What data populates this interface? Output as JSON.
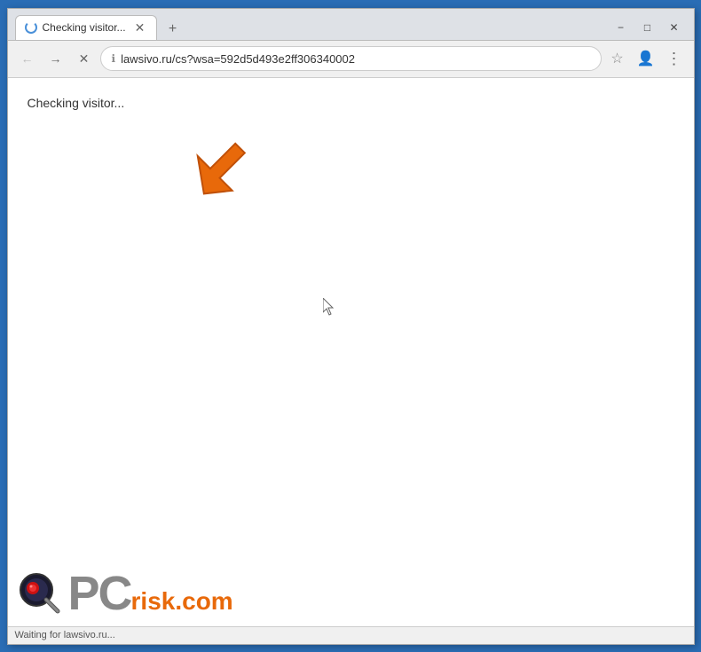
{
  "window": {
    "title": "Checking visitor...",
    "tab_title": "Checking visitor...",
    "new_tab_label": "+",
    "close_label": "✕",
    "minimize_label": "−",
    "maximize_label": "□",
    "close_win_label": "✕"
  },
  "toolbar": {
    "back_label": "←",
    "forward_label": "→",
    "reload_label": "✕",
    "address": "lawsivo.ru/cs?wsa=592d5d493e2ff306340002",
    "star_label": "☆",
    "menu_label": "⋮",
    "profile_label": "👤"
  },
  "page": {
    "checking_text": "Checking visitor..."
  },
  "status_bar": {
    "text": "Waiting for lawsivo.ru..."
  },
  "brand": {
    "pc_text": "PC",
    "risk_text": "risk.com"
  }
}
